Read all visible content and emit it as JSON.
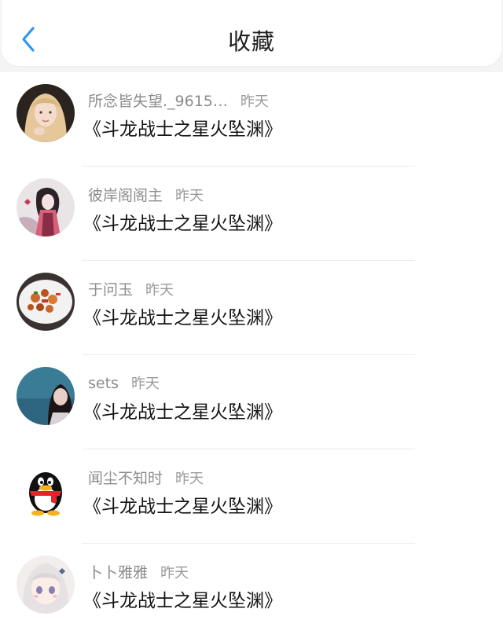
{
  "header": {
    "title": "收藏",
    "back_icon": "chevron-left-icon",
    "accent": "#2f96f3"
  },
  "items": [
    {
      "name": "所念皆失望._9615…",
      "time": "昨天",
      "content": "《斗龙战士之星火坠渊》",
      "avatar": "avatar-girl-blonde"
    },
    {
      "name": "彼岸阁阁主",
      "time": "昨天",
      "content": "《斗龙战士之星火坠渊》",
      "avatar": "avatar-anime-pink"
    },
    {
      "name": "于问玉",
      "time": "昨天",
      "content": "《斗龙战士之星火坠渊》",
      "avatar": "avatar-food-plate"
    },
    {
      "name": "sets",
      "time": "昨天",
      "content": "《斗龙战士之星火坠渊》",
      "avatar": "avatar-girl-sea"
    },
    {
      "name": "闻尘不知时",
      "time": "昨天",
      "content": "《斗龙战士之星火坠渊》",
      "avatar": "avatar-penguin"
    },
    {
      "name": "卜卜雅雅",
      "time": "昨天",
      "content": "《斗龙战士之星火坠渊》",
      "avatar": "avatar-anime-white"
    }
  ]
}
